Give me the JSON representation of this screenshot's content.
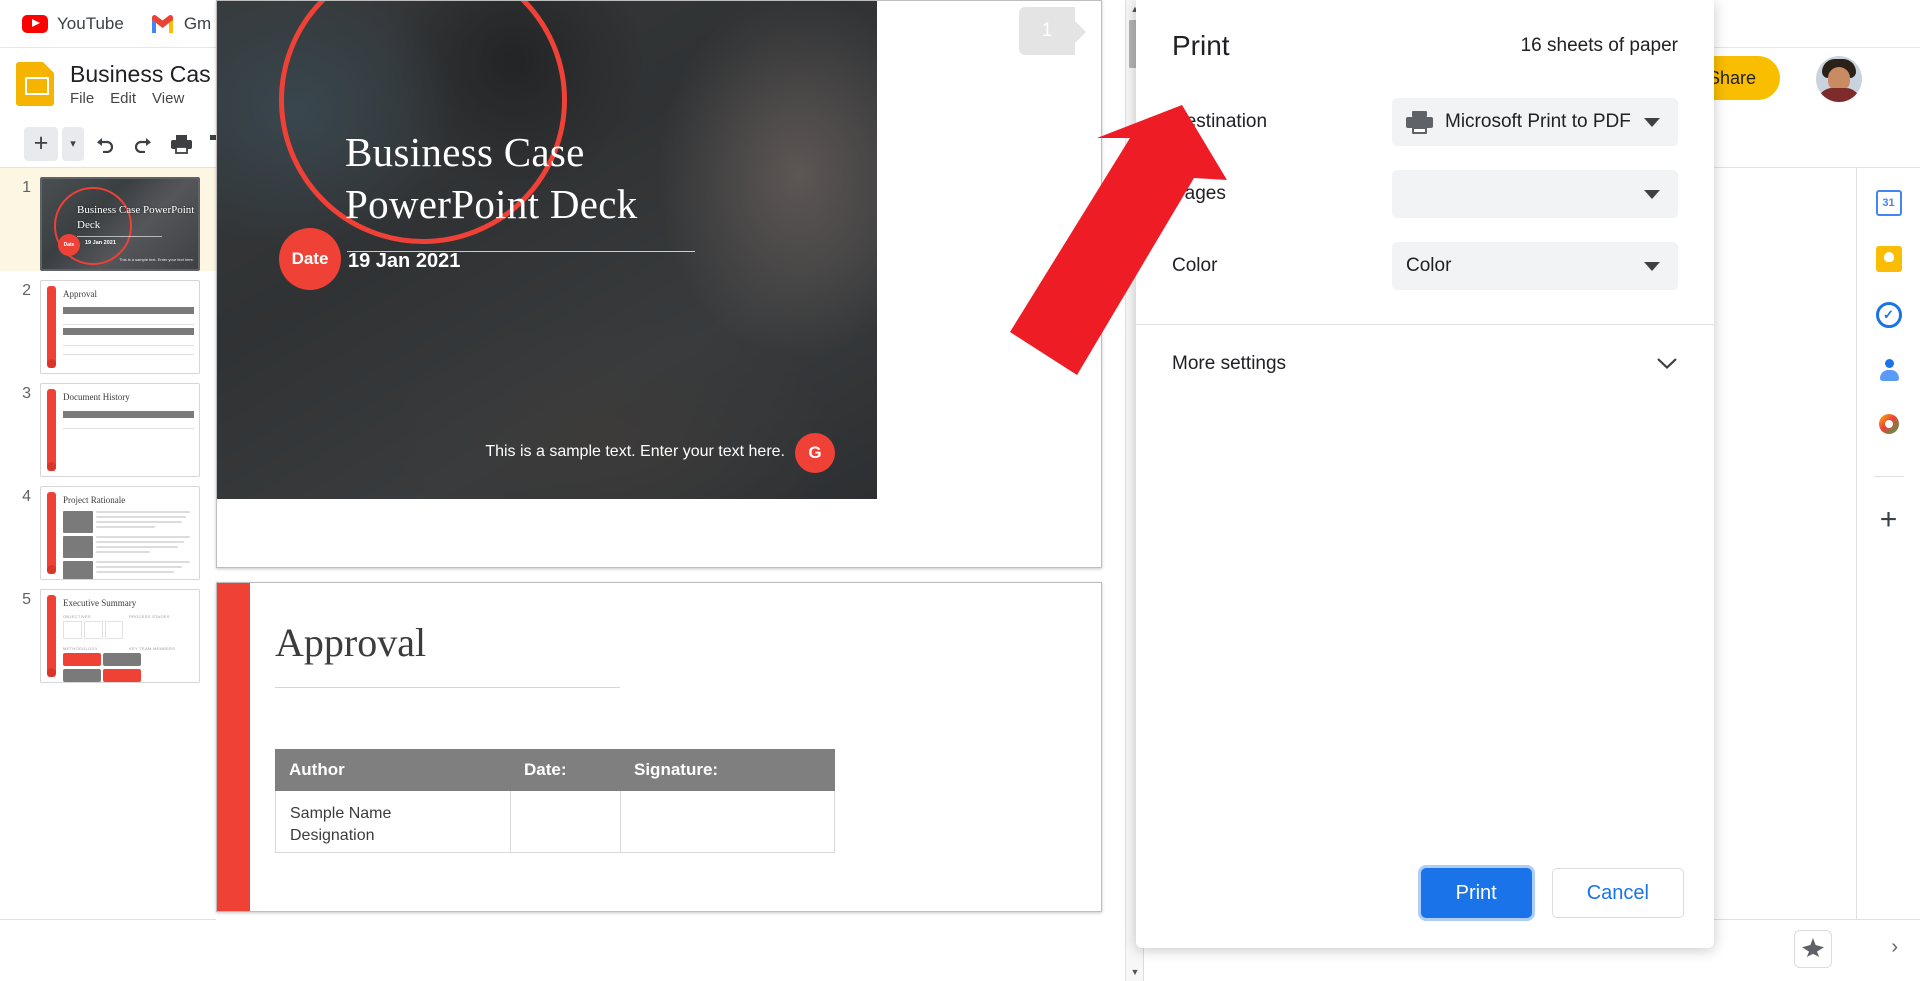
{
  "browser": {
    "bookmarks": [
      {
        "label": "YouTube",
        "icon": "youtube-icon"
      },
      {
        "label": "Gm",
        "icon": "gmail-icon"
      }
    ]
  },
  "slides_app": {
    "doc_title": "Business Cas",
    "menus": [
      "File",
      "Edit",
      "View"
    ],
    "toolbar_icons": [
      "new-slide-icon",
      "new-slide-caret-icon",
      "undo-icon",
      "redo-icon",
      "print-icon",
      "paint-format-icon"
    ],
    "share_label": "Share",
    "hide_menus_icon": "chevron-up-icon",
    "avatar_name": "user-avatar",
    "filmstrip_bottom": {
      "filmstrip_view_icon": "filmstrip-view-icon",
      "grid_view_icon": "grid-view-icon",
      "collapse_icon": "chevron-left-icon"
    },
    "explore_icon": "explore-sparkle-icon",
    "expand_icon": "chevron-right-icon",
    "rail_icons": [
      {
        "name": "google-calendar-icon",
        "label": "31"
      },
      {
        "name": "google-keep-icon",
        "label": ""
      },
      {
        "name": "google-tasks-icon",
        "label": ""
      },
      {
        "name": "google-contacts-icon",
        "label": ""
      },
      {
        "name": "google-maps-icon",
        "label": ""
      },
      {
        "name": "add-ons-plus-icon",
        "label": "+"
      }
    ]
  },
  "filmstrip": {
    "slides": [
      {
        "number": "1",
        "title": "Business Case\nPowerPoint Deck",
        "selected": true,
        "date_badge": "Date",
        "date": "19 Jan 2021",
        "footer": "This is a sample text. Enter your text here."
      },
      {
        "number": "2",
        "title": "Approval",
        "selected": false
      },
      {
        "number": "3",
        "title": "Document History",
        "selected": false
      },
      {
        "number": "4",
        "title": "Project Rationale",
        "selected": false
      },
      {
        "number": "5",
        "title": "Executive Summary",
        "selected": false,
        "sections": [
          "OBJECTIVES",
          "PROCESS STAGES",
          "METHODOLOGY",
          "KEY TEAM MEMBERS"
        ]
      }
    ]
  },
  "preview": {
    "page_badge": "1",
    "page1": {
      "title": "Business Case\nPowerPoint Deck",
      "date_badge": "Date",
      "date": "19 Jan 2021",
      "footer_text": "This is a sample text. Enter your text here.",
      "avatar_letter": "G"
    },
    "page2": {
      "title": "Approval",
      "columns": [
        "Author",
        "Date:",
        "Signature:"
      ],
      "rows": [
        [
          "Sample Name\nDesignation",
          "",
          ""
        ]
      ]
    }
  },
  "print_dialog": {
    "title": "Print",
    "sheets": "16 sheets of paper",
    "rows": [
      {
        "label": "Destination",
        "value": "Microsoft Print to PDF",
        "icon": "printer-icon",
        "name": "destination"
      },
      {
        "label": "Pages",
        "value": "",
        "icon": "",
        "name": "pages"
      },
      {
        "label": "Color",
        "value": "Color",
        "icon": "",
        "name": "color"
      }
    ],
    "more_settings_label": "More settings",
    "print_button": "Print",
    "cancel_button": "Cancel",
    "accent_color": "#1a73e8"
  },
  "annotation": {
    "arrow_color": "#ee1c25",
    "points_to": "Destination"
  }
}
